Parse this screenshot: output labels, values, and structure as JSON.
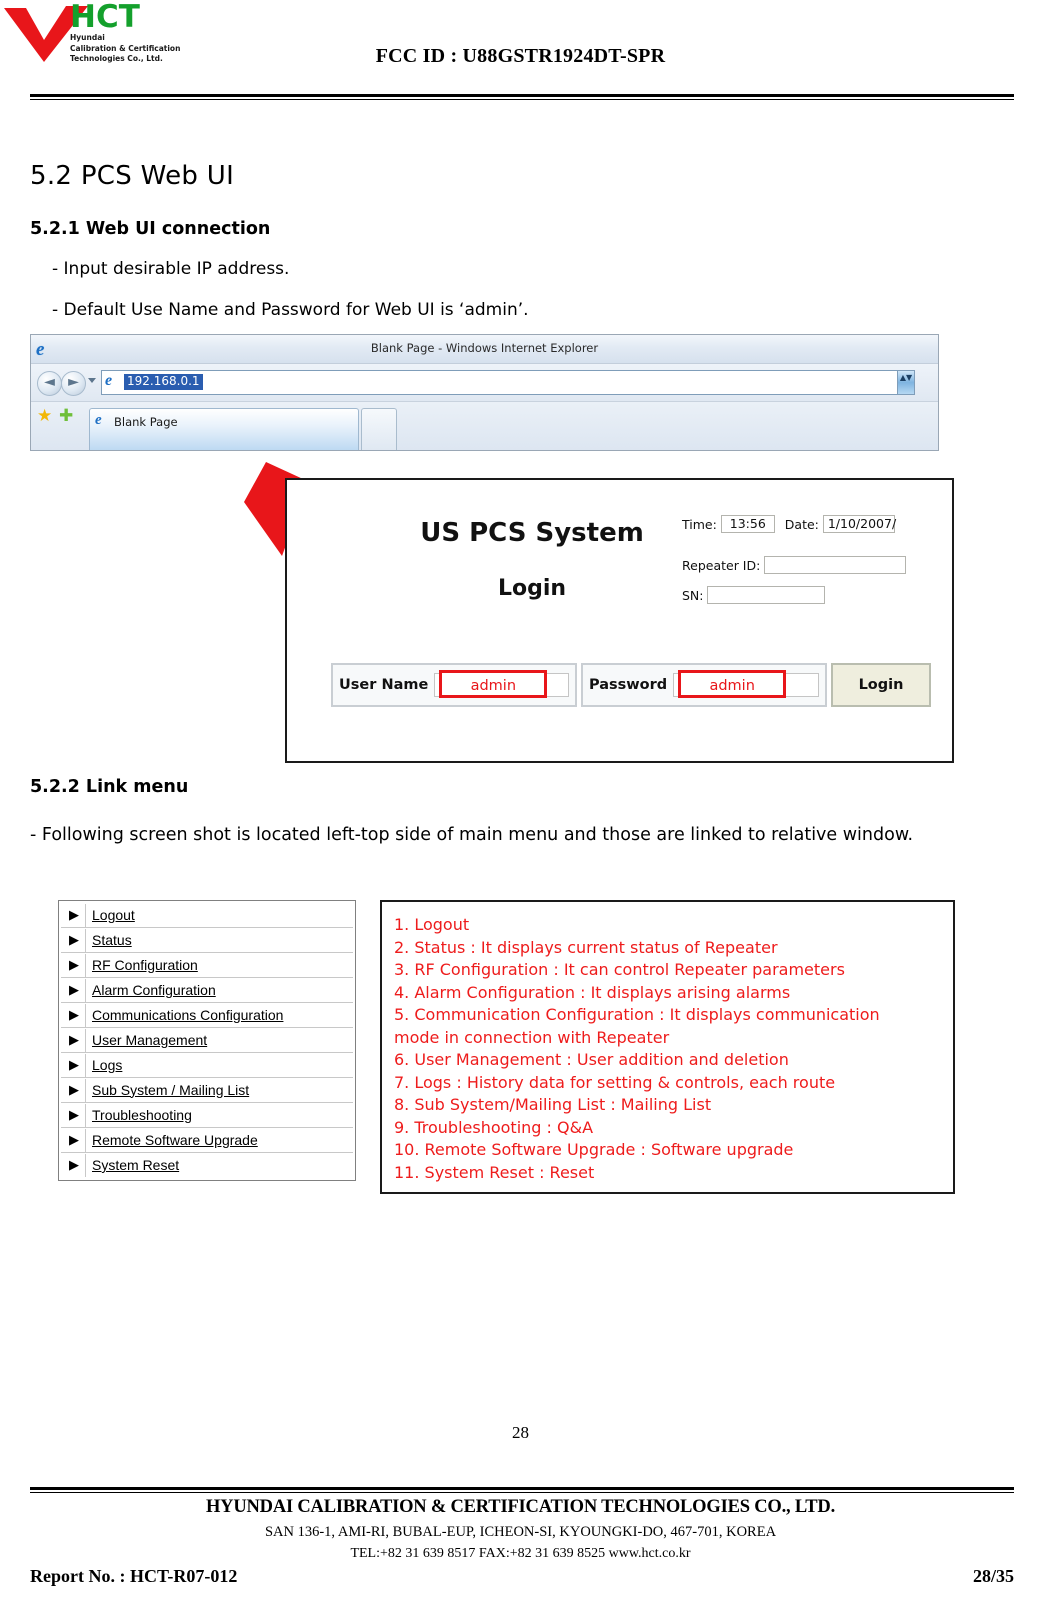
{
  "header": {
    "logo": {
      "brand": "HCT",
      "sub_line1": "Hyundai",
      "sub_line2": "Calibration & Certification",
      "sub_line3": "Technologies Co., Ltd.",
      "brand_color": "#14a02c",
      "check_color": "#e8161a"
    },
    "fcc_id": "FCC ID : U88GSTR1924DT-SPR"
  },
  "content": {
    "section_title": "5.2 PCS Web UI",
    "sub_5_2_1": "5.2.1 Web UI  connection",
    "bullet_1": "- Input desirable IP address.",
    "bullet_2": "- Default Use Name and Password for Web UI  is ‘admin’.",
    "sub_5_2_2": "5.2.2 Link menu",
    "para_5_2_2": "- Following screen shot is located left-top side of main menu and those are linked to relative window."
  },
  "browser": {
    "window_title": "Blank Page - Windows Internet Explorer",
    "url_value": "192.168.0.1",
    "tab_label": "Blank Page",
    "back_glyph": "◄",
    "forward_glyph": "►",
    "spinner_glyph": "▲▼",
    "favorites_star": "★",
    "add_favorites_star": "✚",
    "favicon_letter": "e"
  },
  "login_panel": {
    "system_title": "US PCS System",
    "login_heading": "Login",
    "time_label": "Time:",
    "time_value": "13:56",
    "date_label": "Date:",
    "date_value": "1/10/2007/",
    "repeater_label": "Repeater ID:",
    "repeater_value": "",
    "sn_label": "SN:",
    "sn_value": "",
    "username_label": "User Name",
    "username_value": "admin",
    "password_label": "Password",
    "password_value": "admin",
    "login_button": "Login",
    "highlight_color": "#e8161a"
  },
  "link_menu": {
    "items": [
      {
        "bullet": "▶",
        "label": "Logout"
      },
      {
        "bullet": "▶",
        "label": "Status"
      },
      {
        "bullet": "▶",
        "label": "RF Configuration"
      },
      {
        "bullet": "▶",
        "label": "Alarm Configuration"
      },
      {
        "bullet": "▶",
        "label": "Communications Configuration"
      },
      {
        "bullet": "▶",
        "label": "User Management"
      },
      {
        "bullet": "▶",
        "label": "Logs"
      },
      {
        "bullet": "▶",
        "label": "Sub System / Mailing List"
      },
      {
        "bullet": "▶",
        "label": "Troubleshooting"
      },
      {
        "bullet": "▶",
        "label": "Remote Software Upgrade"
      },
      {
        "bullet": "▶",
        "label": "System Reset"
      }
    ]
  },
  "description_box": {
    "text_color": "#ee1c1c",
    "lines": [
      "1. Logout",
      "2. Status : It displays current status of Repeater",
      "3. RF Configuration : It can control Repeater parameters",
      "4. Alarm Configuration : It displays arising alarms",
      "5. Communication Configuration : It displays communication",
      "mode in connection with Repeater",
      "6. User Management : User addition and deletion",
      "7. Logs : History data for setting & controls, each route",
      "8. Sub System/Mailing List : Mailing List",
      "9. Troubleshooting :  Q&A",
      "10. Remote Software Upgrade :  Software upgrade",
      "11. System Reset : Reset"
    ]
  },
  "footer": {
    "page_number": "28",
    "company": "HYUNDAI CALIBRATION & CERTIFICATION TECHNOLOGIES CO., LTD.",
    "address": "SAN 136-1, AMI-RI, BUBAL-EUP, ICHEON-SI, KYOUNGKI-DO, 467-701, KOREA",
    "contact": "TEL:+82 31 639 8517    FAX:+82 31 639 8525    www.hct.co.kr",
    "report_no": "Report No. :  HCT-R07-012",
    "page_of": "28/35"
  }
}
